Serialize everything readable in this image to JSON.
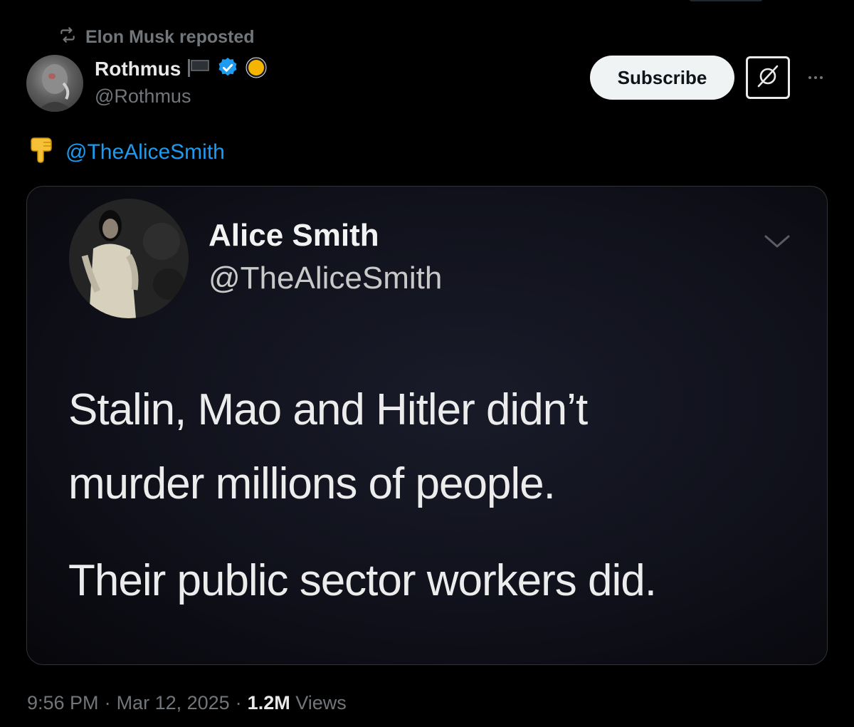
{
  "repost": {
    "label": "Elon Musk reposted"
  },
  "author": {
    "name": "Rothmus",
    "handle": "@Rothmus"
  },
  "actions": {
    "subscribe_label": "Subscribe"
  },
  "tweet": {
    "mention": "@TheAliceSmith"
  },
  "media": {
    "name": "Alice Smith",
    "handle": "@TheAliceSmith",
    "lines": [
      "Stalin, Mao and Hitler didn’t",
      "murder millions of people.",
      "Their public sector workers did."
    ]
  },
  "footer": {
    "time": "9:56 PM",
    "sep1": "·",
    "date": "Mar 12, 2025",
    "sep2": "·",
    "views_count": "1.2M",
    "views_label": "Views"
  },
  "colors": {
    "background": "#000000",
    "accent": "#1d9bf0",
    "verified": "#1d9bf0",
    "muted": "#71767b",
    "subscribe_bg": "#eff3f4"
  },
  "icons": [
    "repost-icon",
    "flag-icon",
    "verified-badge-icon",
    "yellow-circle-icon",
    "grok-icon",
    "more-icon",
    "pointing-down-icon",
    "chevron-down-icon"
  ]
}
